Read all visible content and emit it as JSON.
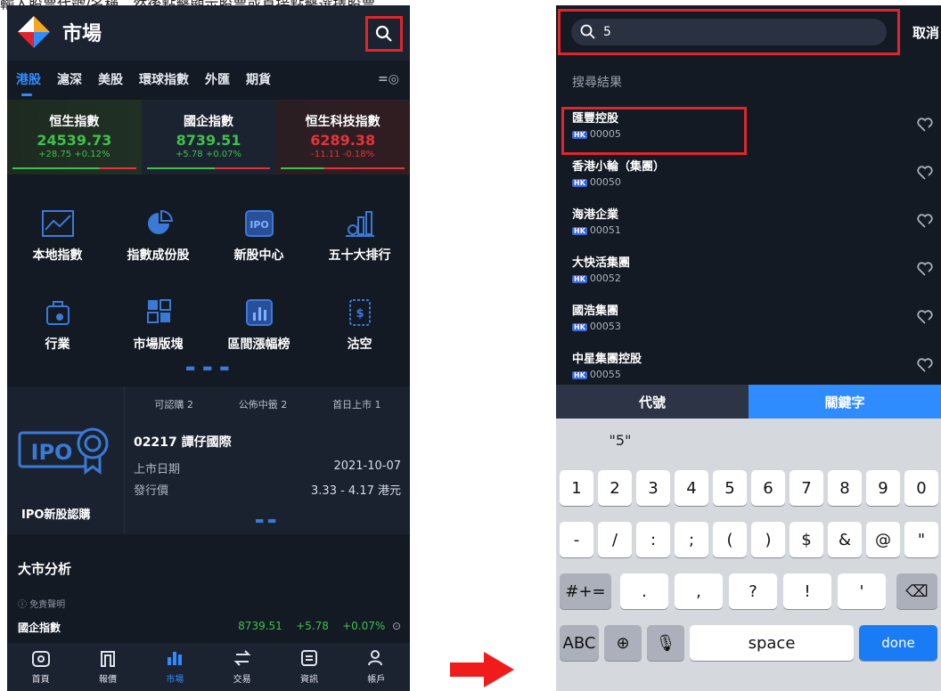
{
  "caption": "輸入股票代號/名稱，然後點擊顯示股票或直接點擊選擇股票",
  "left": {
    "title": "市場",
    "tabs": [
      "港股",
      "滬深",
      "美股",
      "環球指數",
      "外匯",
      "期貨"
    ],
    "indices": [
      {
        "name": "恒生指數",
        "value": "24539.73",
        "change": "+28.75 +0.12%",
        "dir": "up"
      },
      {
        "name": "國企指數",
        "value": "8739.51",
        "change": "+5.78 +0.07%",
        "dir": "up"
      },
      {
        "name": "恒生科技指數",
        "value": "6289.38",
        "change": "-11.11 -0.18%",
        "dir": "down"
      }
    ],
    "grid": [
      "本地指數",
      "指數成份股",
      "新股中心",
      "五十大排行",
      "行業",
      "市場版塊",
      "區間漲幅榜",
      "沽空"
    ],
    "ipo": {
      "tabs": [
        "可認購 2",
        "公佈中籤 2",
        "首日上市 1"
      ],
      "name": "02217 譚仔國際",
      "listing_label": "上市日期",
      "listing_value": "2021-10-07",
      "price_label": "發行價",
      "price_value": "3.33 - 4.17 港元",
      "label": "IPO新股認購"
    },
    "market": {
      "title": "大市分析",
      "disclaimer": "免責聲明",
      "row_name": "國企指數",
      "row_value": "8739.51",
      "row_change": "+5.78",
      "row_pct": "+0.07%"
    },
    "nav": [
      "首頁",
      "報價",
      "市場",
      "交易",
      "資訊",
      "帳戶"
    ]
  },
  "right": {
    "query": "5",
    "cancel": "取消",
    "results_title": "搜尋結果",
    "results": [
      {
        "name": "匯豐控股",
        "code": "00005"
      },
      {
        "name": "香港小輪（集團）",
        "code": "00050"
      },
      {
        "name": "海港企業",
        "code": "00051"
      },
      {
        "name": "大快活集團",
        "code": "00052"
      },
      {
        "name": "國浩集團",
        "code": "00053"
      },
      {
        "name": "中星集團控股",
        "code": "00055"
      }
    ],
    "market_tag": "HK",
    "modes": [
      "代號",
      "關鍵字"
    ],
    "suggestion": "\"5\"",
    "keys_row1": [
      "1",
      "2",
      "3",
      "4",
      "5",
      "6",
      "7",
      "8",
      "9",
      "0"
    ],
    "keys_row2": [
      "-",
      "/",
      ":",
      ";",
      "(",
      ")",
      "$",
      "&",
      "@",
      "\""
    ],
    "keys_row3": [
      ".",
      ",",
      "?",
      "!",
      "'"
    ],
    "key_symbols": "#+=",
    "key_abc": "ABC",
    "key_space": "space",
    "key_done": "done"
  },
  "colors": {
    "accent": "#2f8cff",
    "highlight": "#e0252b",
    "up": "#3fc14c",
    "down": "#e3343a"
  }
}
